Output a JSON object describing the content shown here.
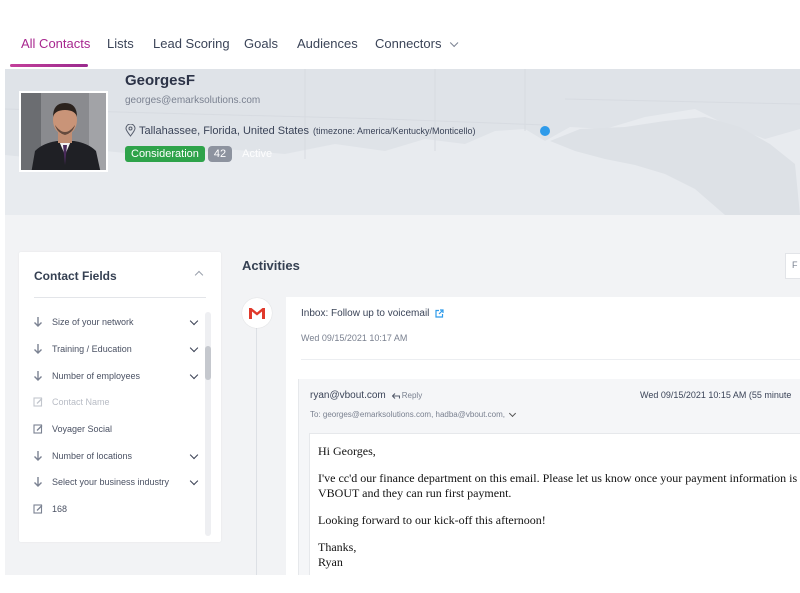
{
  "nav": {
    "tabs": [
      {
        "label": "All Contacts",
        "active": true
      },
      {
        "label": "Lists"
      },
      {
        "label": "Lead Scoring"
      },
      {
        "label": "Goals"
      },
      {
        "label": "Audiences"
      },
      {
        "label": "Connectors",
        "has_dropdown": true
      }
    ]
  },
  "contact": {
    "name": "GeorgesF",
    "email": "georges@emarksolutions.com",
    "location": "Tallahassee, Florida, United States",
    "timezone": "(timezone: America/Kentucky/Monticello)",
    "stage": "Consideration",
    "score": "42",
    "status": "Active"
  },
  "contact_fields": {
    "title": "Contact Fields",
    "rows": [
      {
        "icon": "arrow-down-icon",
        "label": "Size of your network",
        "dropdown": true
      },
      {
        "icon": "arrow-down-icon",
        "label": "Training / Education",
        "dropdown": true
      },
      {
        "icon": "arrow-down-icon",
        "label": "Number of employees",
        "dropdown": true
      },
      {
        "icon": "edit-icon",
        "label": "Contact Name",
        "muted": true
      },
      {
        "icon": "edit-icon",
        "label": "Voyager Social"
      },
      {
        "icon": "arrow-down-icon",
        "label": "Number of locations",
        "dropdown": true
      },
      {
        "icon": "arrow-down-icon",
        "label": "Select your business industry",
        "dropdown": true
      },
      {
        "icon": "edit-icon",
        "label": "168"
      }
    ]
  },
  "activities": {
    "title": "Activities",
    "filter_label": "F",
    "item": {
      "subject": "Inbox: Follow up to voicemail",
      "date": "Wed 09/15/2021 10:17 AM"
    },
    "email": {
      "from": "ryan@vbout.com",
      "reply_label": "Reply",
      "date": "Wed 09/15/2021 10:15 AM (55 minute",
      "to": "To: georges@emarksolutions.com, hadba@vbout.com,",
      "body": {
        "greeting": "Hi Georges,",
        "line1": "I've cc'd our finance department on this email.  Please let us know once your payment information is",
        "line2": "VBOUT and they can run first payment.",
        "line3": "Looking forward to our kick-off this afternoon!",
        "signoff": "Thanks,",
        "signature": "Ryan"
      }
    }
  },
  "colors": {
    "accent": "#a8278f",
    "stage_green": "#2ea34a",
    "map_dot": "#2f9bea"
  }
}
